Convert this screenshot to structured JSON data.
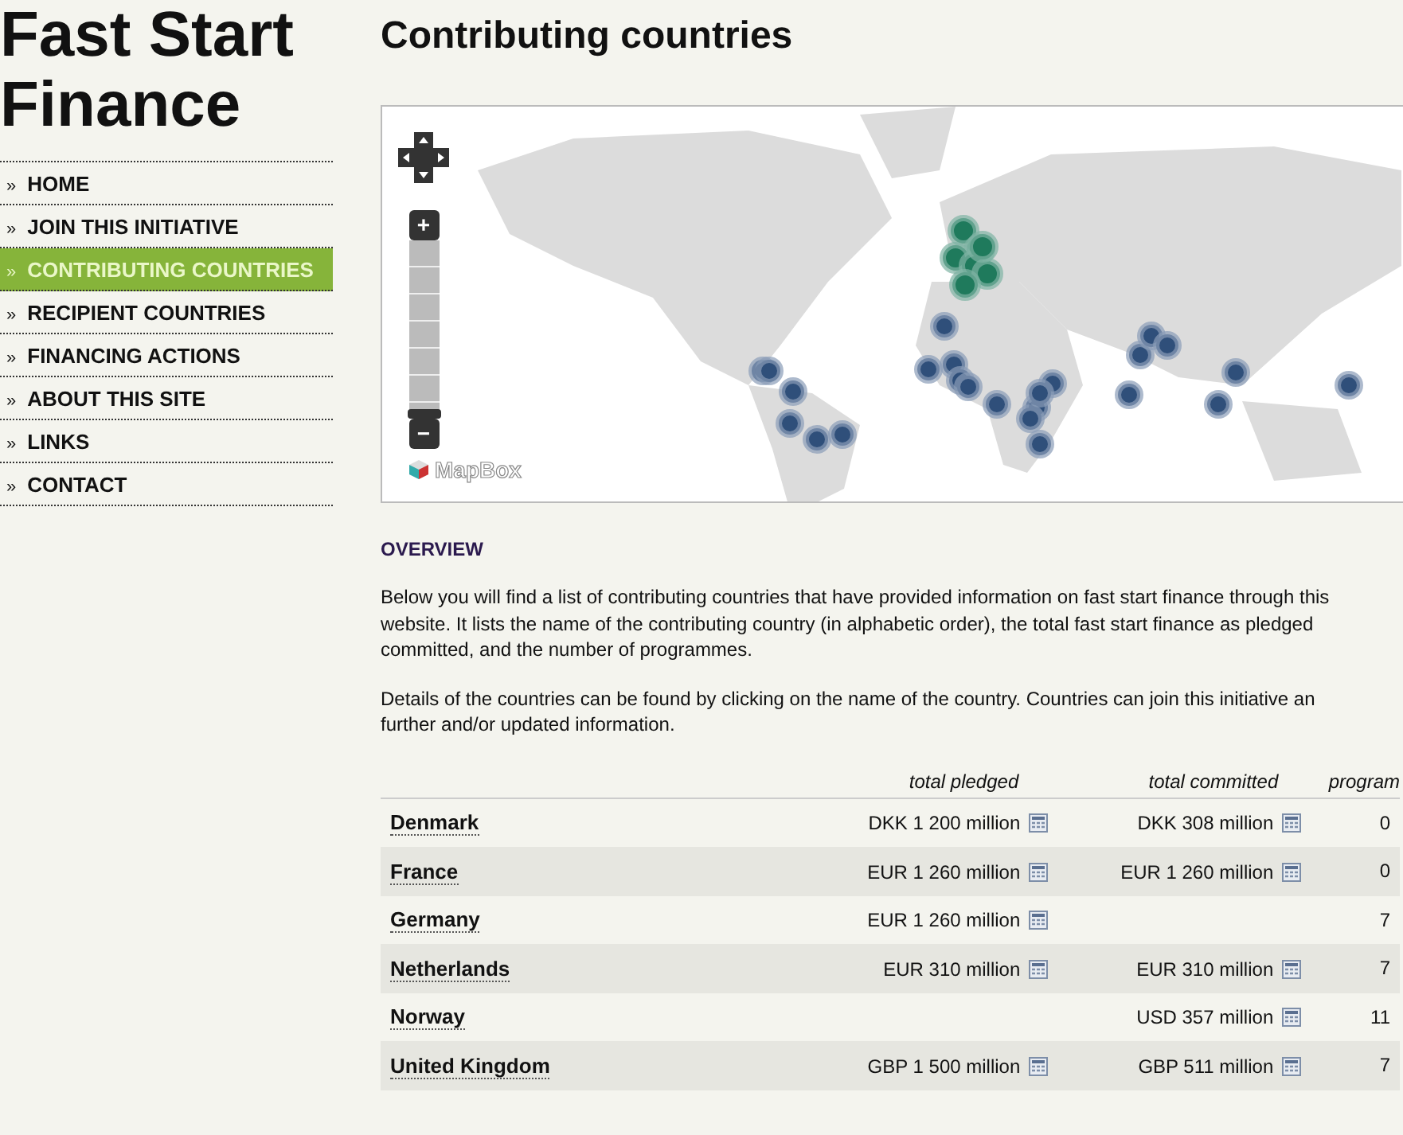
{
  "site_title": "Fast Start Finance",
  "nav": [
    {
      "label": "HOME",
      "selected": false
    },
    {
      "label": "JOIN THIS INITIATIVE",
      "selected": false
    },
    {
      "label": "CONTRIBUTING COUNTRIES",
      "selected": true
    },
    {
      "label": "RECIPIENT COUNTRIES",
      "selected": false
    },
    {
      "label": "FINANCING ACTIONS",
      "selected": false
    },
    {
      "label": "ABOUT THIS SITE",
      "selected": false
    },
    {
      "label": "LINKS",
      "selected": false
    },
    {
      "label": "CONTACT",
      "selected": false
    }
  ],
  "nav_marker": "»",
  "page_title": "Contributing countries",
  "map": {
    "attribution": "MapBox",
    "zoom_in": "+",
    "zoom_out": "−",
    "zoom": {
      "level": 0
    }
  },
  "overview": {
    "heading": "OVERVIEW",
    "paragraphs": [
      [
        "Below you will find a list of contributing countries that have provided information on fast start finance through this",
        "website. It lists the name of the contributing country (in alphabetic order), the total fast start finance as pledged",
        "committed, and the number of programmes."
      ],
      [
        "Details of the countries can be found by clicking on the name of the country. Countries can join this initiative an",
        "further and/or updated information."
      ]
    ]
  },
  "table": {
    "columns": [
      "total pledged",
      "total committed",
      "program"
    ],
    "rows": [
      {
        "country": "Denmark",
        "pledged": "DKK 1 200 million",
        "committed": "DKK 308 million",
        "programmes": "0"
      },
      {
        "country": "France",
        "pledged": "EUR 1 260 million",
        "committed": "EUR 1 260 million",
        "programmes": "0"
      },
      {
        "country": "Germany",
        "pledged": "EUR 1 260 million",
        "committed": "",
        "programmes": "7"
      },
      {
        "country": "Netherlands",
        "pledged": "EUR 310 million",
        "committed": "EUR 310 million",
        "programmes": "7"
      },
      {
        "country": "Norway",
        "pledged": "",
        "committed": "USD 357 million",
        "programmes": "11"
      },
      {
        "country": "United Kingdom",
        "pledged": "GBP 1 500 million",
        "committed": "GBP 511 million",
        "programmes": "7"
      }
    ]
  }
}
